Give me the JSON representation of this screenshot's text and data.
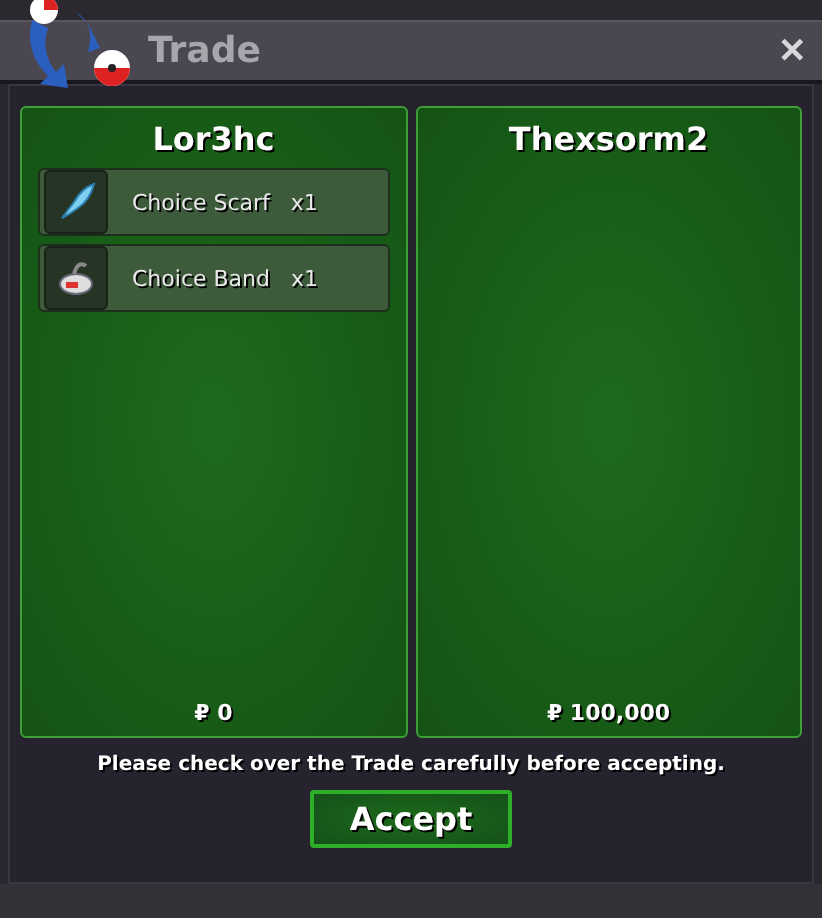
{
  "window": {
    "title": "Trade",
    "close": "✕"
  },
  "panels": [
    {
      "name": "Lor3hc",
      "items": [
        {
          "kind": "scarf",
          "name": "Choice Scarf",
          "qty": "x1"
        },
        {
          "kind": "band",
          "name": "Choice Band",
          "qty": "x1"
        }
      ],
      "money": "₽ 0"
    },
    {
      "name": "Thexsorm2",
      "money": "₽ 100,000"
    }
  ],
  "notice": "Please check over the Trade carefully before accepting.",
  "accept": "Accept"
}
